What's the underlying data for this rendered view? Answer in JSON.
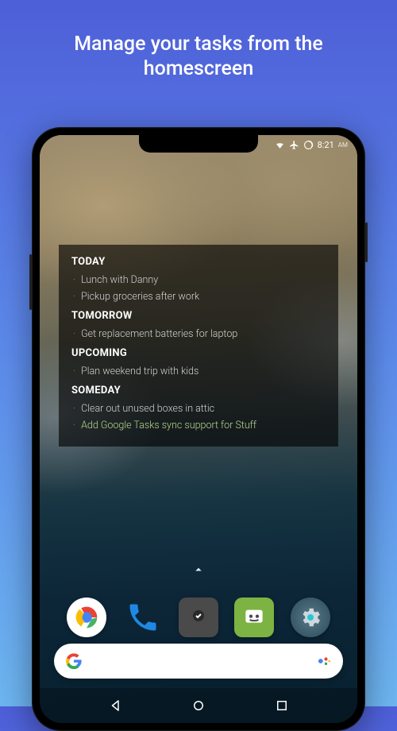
{
  "hero": {
    "line1": "Manage your tasks from the",
    "line2": "homescreen"
  },
  "status_bar": {
    "time": "8:21",
    "ampm": "AM"
  },
  "widget": {
    "sections": [
      {
        "header": "TODAY",
        "items": [
          {
            "text": "Lunch with Danny",
            "highlight": false
          },
          {
            "text": "Pickup groceries after work",
            "highlight": false
          }
        ]
      },
      {
        "header": "TOMORROW",
        "items": [
          {
            "text": "Get replacement batteries for laptop",
            "highlight": false
          }
        ]
      },
      {
        "header": "UPCOMING",
        "items": [
          {
            "text": "Plan weekend trip with kids",
            "highlight": false
          }
        ]
      },
      {
        "header": "SOMEDAY",
        "items": [
          {
            "text": "Clear out unused boxes in attic",
            "highlight": false
          },
          {
            "text": "Add Google Tasks sync support for Stuff",
            "highlight": true
          }
        ]
      }
    ]
  },
  "dock": {
    "apps": [
      {
        "name": "chrome"
      },
      {
        "name": "phone"
      },
      {
        "name": "tasks"
      },
      {
        "name": "messages"
      },
      {
        "name": "settings"
      }
    ]
  }
}
